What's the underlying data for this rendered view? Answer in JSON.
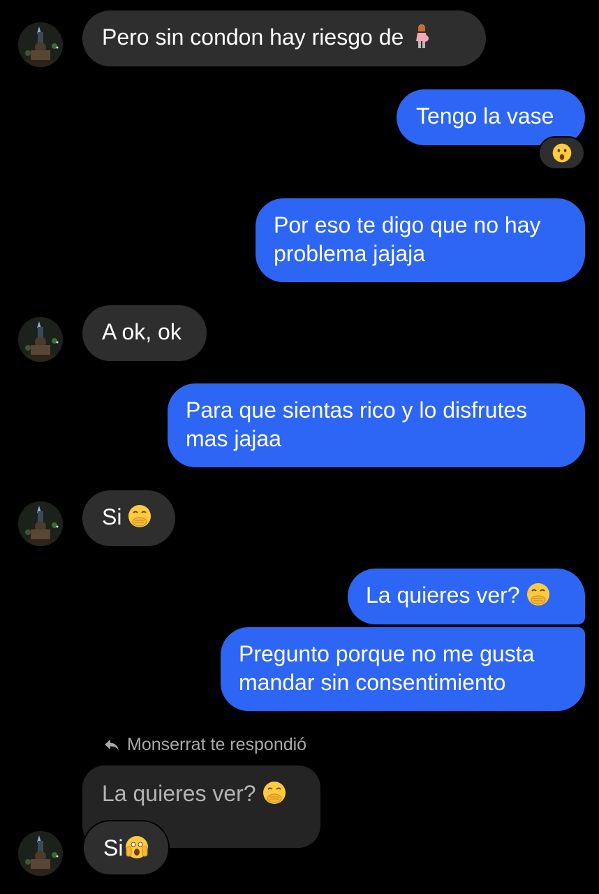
{
  "conversation": {
    "messages": [
      {
        "direction": "incoming",
        "text": "Pero sin condon hay riesgo de",
        "emoji": "pregnant-woman-emoji"
      },
      {
        "direction": "outgoing",
        "text": "Tengo la vase",
        "reaction": "surprised-face-emoji"
      },
      {
        "direction": "outgoing",
        "lines": [
          "Por eso te digo que no hay",
          "problema jajaja"
        ]
      },
      {
        "direction": "incoming",
        "text": "A ok, ok"
      },
      {
        "direction": "outgoing",
        "lines": [
          "Para que sientas rico y lo disfrutes",
          "mas jajaa"
        ]
      },
      {
        "direction": "incoming",
        "text": "Si",
        "emoji": "face-with-hand-over-mouth-emoji"
      },
      {
        "direction": "outgoing",
        "text": "La quieres ver?",
        "emoji": "face-with-hand-over-mouth-emoji"
      },
      {
        "direction": "outgoing",
        "lines": [
          "Pregunto porque no me gusta",
          "mandar sin consentimiento"
        ]
      },
      {
        "direction": "incoming",
        "text": "Si",
        "emoji": "face-screaming-with-hands-emoji"
      }
    ],
    "reply": {
      "label": "Monserrat te respondió",
      "quoted_text": "La quieres ver?",
      "quoted_emoji": "face-with-hand-over-mouth-emoji"
    }
  },
  "colors": {
    "background": "#000000",
    "incoming_bubble": "#2e2e2e",
    "outgoing_bubble": "#2d66f5",
    "quoted_bubble": "#242424",
    "secondary_text": "#a9a9a9"
  }
}
